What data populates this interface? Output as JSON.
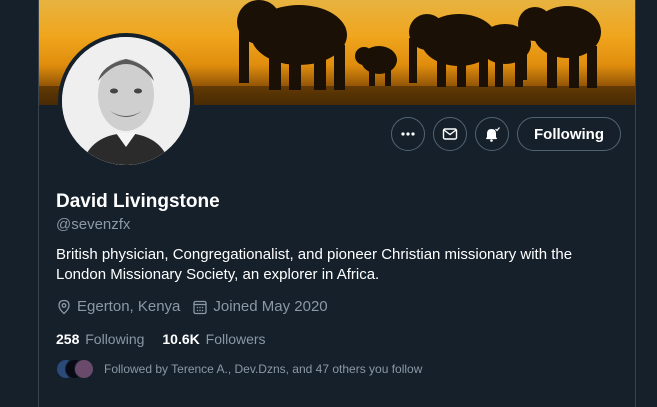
{
  "profile": {
    "name": "David Livingstone",
    "handle": "@sevenzfx",
    "bio_line1": "British physician, Congregationalist, and pioneer Christian missionary with the",
    "bio_line2": "London Missionary Society, an explorer in Africa.",
    "location": "Egerton, Kenya",
    "joined": "Joined May 2020"
  },
  "actions": {
    "more_icon": "more-horizontal-icon",
    "message_icon": "envelope-icon",
    "notify_icon": "bell-check-icon",
    "following_label": "Following"
  },
  "stats": {
    "following_count": "258",
    "following_label": "Following",
    "followers_count": "10.6K",
    "followers_label": "Followers"
  },
  "followed_by": "Followed by Terence A., Dev.Dzns, and 47 others you follow",
  "colors": {
    "background": "#15202b",
    "secondary_text": "#8b98a5",
    "border": "#536471",
    "banner_accent": "#f0a51d"
  }
}
